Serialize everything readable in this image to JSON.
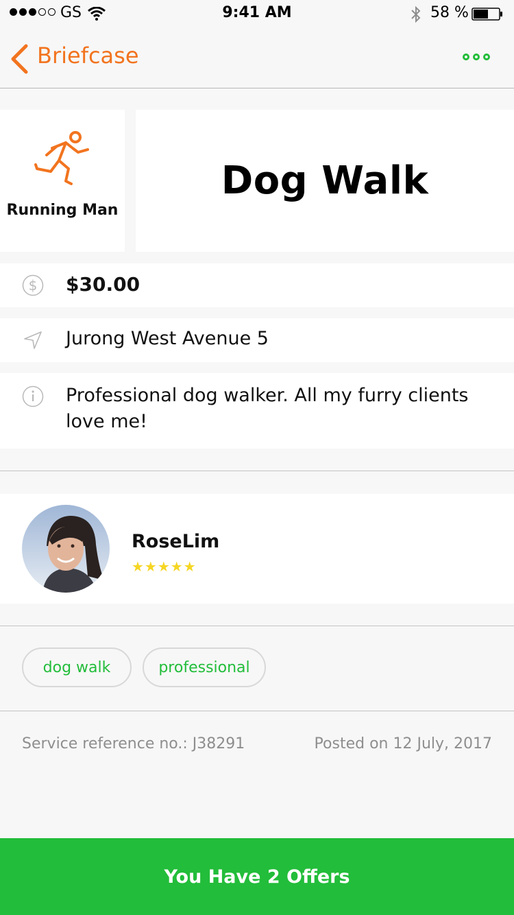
{
  "status_bar": {
    "carrier": "GS",
    "time": "9:41 AM",
    "battery": "58 %",
    "battery_level": 0.58
  },
  "nav": {
    "back_label": "Briefcase"
  },
  "service": {
    "category_label": "Running Man",
    "title": "Dog Walk",
    "price": "$30.00",
    "location": "Jurong West Avenue 5",
    "description": "Professional dog walker. All my furry clients love me!"
  },
  "owner": {
    "name": "RoseLim",
    "stars": "★★★★★",
    "rating": 5
  },
  "tags": [
    "dog walk",
    "professional"
  ],
  "meta": {
    "reference": "Service reference no.: J38291",
    "posted": "Posted on 12 July, 2017"
  },
  "cta": {
    "label": "You Have 2 Offers"
  },
  "colors": {
    "accent_orange": "#f2741f",
    "accent_green": "#22bd3a",
    "star_yellow": "#f5d623"
  }
}
